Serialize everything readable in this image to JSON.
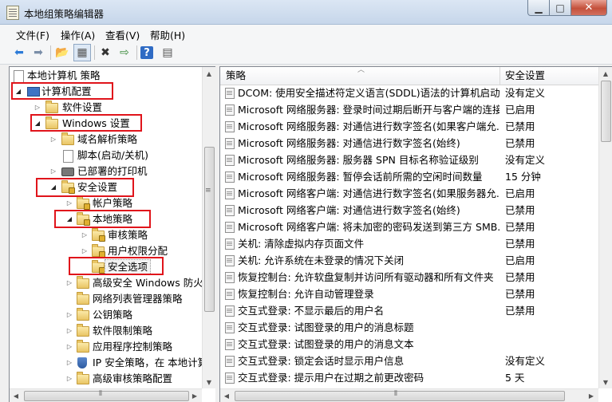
{
  "window": {
    "title": "本地组策略编辑器"
  },
  "menu": [
    "文件(F)",
    "操作(A)",
    "查看(V)",
    "帮助(H)"
  ],
  "toolbar": {
    "icons": [
      "back-icon",
      "forward-icon",
      "up-folder-icon",
      "show-hide-tree-icon",
      "delete-icon",
      "export-list-icon",
      "help-icon",
      "properties-icon"
    ]
  },
  "tree": {
    "root": "本地计算机 策略",
    "computer_config": "计算机配置",
    "software_settings": "软件设置",
    "windows_settings": "Windows 设置",
    "dns_policy": "域名解析策略",
    "scripts": "脚本(启动/关机)",
    "printers": "已部署的打印机",
    "security_settings": "安全设置",
    "account_policies": "帐户策略",
    "local_policies": "本地策略",
    "audit_policy": "审核策略",
    "user_rights": "用户权限分配",
    "security_options": "安全选项",
    "firewall": "高级安全 Windows 防火墙",
    "network_list": "网络列表管理器策略",
    "public_key": "公钥策略",
    "software_restriction": "软件限制策略",
    "app_control": "应用程序控制策略",
    "ipsec": "IP 安全策略，在 本地计算机",
    "advanced_audit": "高级审核策略配置"
  },
  "list": {
    "col_policy": "策略",
    "col_setting": "安全设置",
    "rows": [
      {
        "name": "DCOM: 使用安全描述符定义语言(SDDL)语法的计算机启动...",
        "setting": "没有定义"
      },
      {
        "name": "Microsoft 网络服务器: 登录时间过期后断开与客户端的连接",
        "setting": "已启用"
      },
      {
        "name": "Microsoft 网络服务器: 对通信进行数字签名(如果客户端允...",
        "setting": "已禁用"
      },
      {
        "name": "Microsoft 网络服务器: 对通信进行数字签名(始终)",
        "setting": "已禁用"
      },
      {
        "name": "Microsoft 网络服务器: 服务器 SPN 目标名称验证级别",
        "setting": "没有定义"
      },
      {
        "name": "Microsoft 网络服务器: 暂停会话前所需的空闲时间数量",
        "setting": "15 分钟"
      },
      {
        "name": "Microsoft 网络客户端: 对通信进行数字签名(如果服务器允...",
        "setting": "已启用"
      },
      {
        "name": "Microsoft 网络客户端: 对通信进行数字签名(始终)",
        "setting": "已禁用"
      },
      {
        "name": "Microsoft 网络客户端: 将未加密的密码发送到第三方 SMB...",
        "setting": "已禁用"
      },
      {
        "name": "关机: 清除虚拟内存页面文件",
        "setting": "已禁用"
      },
      {
        "name": "关机: 允许系统在未登录的情况下关闭",
        "setting": "已启用"
      },
      {
        "name": "恢复控制台: 允许软盘复制并访问所有驱动器和所有文件夹",
        "setting": "已禁用"
      },
      {
        "name": "恢复控制台: 允许自动管理登录",
        "setting": "已禁用"
      },
      {
        "name": "交互式登录: 不显示最后的用户名",
        "setting": "已禁用"
      },
      {
        "name": "交互式登录: 试图登录的用户的消息标题",
        "setting": ""
      },
      {
        "name": "交互式登录: 试图登录的用户的消息文本",
        "setting": ""
      },
      {
        "name": "交互式登录: 锁定会话时显示用户信息",
        "setting": "没有定义"
      },
      {
        "name": "交互式登录: 提示用户在过期之前更改密码",
        "setting": "5 天"
      }
    ]
  }
}
